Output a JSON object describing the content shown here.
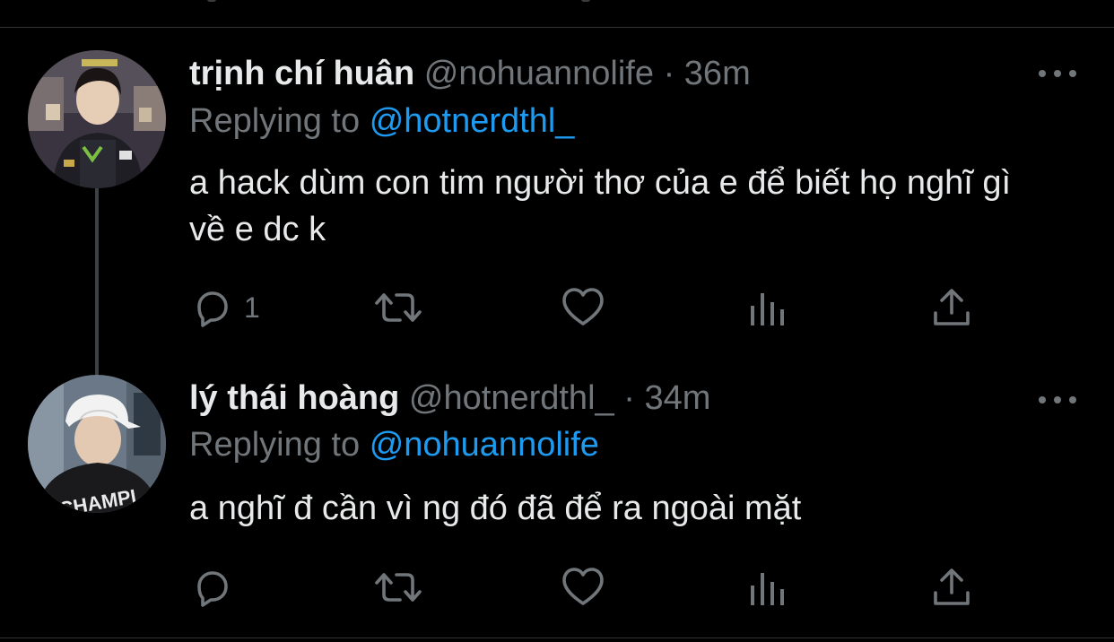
{
  "colors": {
    "background": "#000000",
    "text_primary": "#e7e9ea",
    "text_secondary": "#71767b",
    "accent": "#1d9bf0",
    "divider": "#2f3336"
  },
  "tweets": [
    {
      "display_name": "trịnh chí huân",
      "handle": "@nohuannolife",
      "separator": "·",
      "time": "36m",
      "replying_prefix": "Replying to",
      "replying_to": "@hotnerdthl_",
      "text": "a hack dùm con tim người thơ của e để biết họ nghĩ gì về e dc k",
      "reply_count": "1",
      "more_icon": "more-icon"
    },
    {
      "display_name": "lý thái hoàng",
      "handle": "@hotnerdthl_",
      "separator": "·",
      "time": "34m",
      "replying_prefix": "Replying to",
      "replying_to": "@nohuannolife",
      "text": "a nghĩ đ cần vì ng đó đã để ra ngoài mặt",
      "reply_count": "",
      "more_icon": "more-icon"
    }
  ],
  "action_icons": [
    "reply-icon",
    "retweet-icon",
    "like-icon",
    "analytics-icon",
    "share-icon"
  ]
}
